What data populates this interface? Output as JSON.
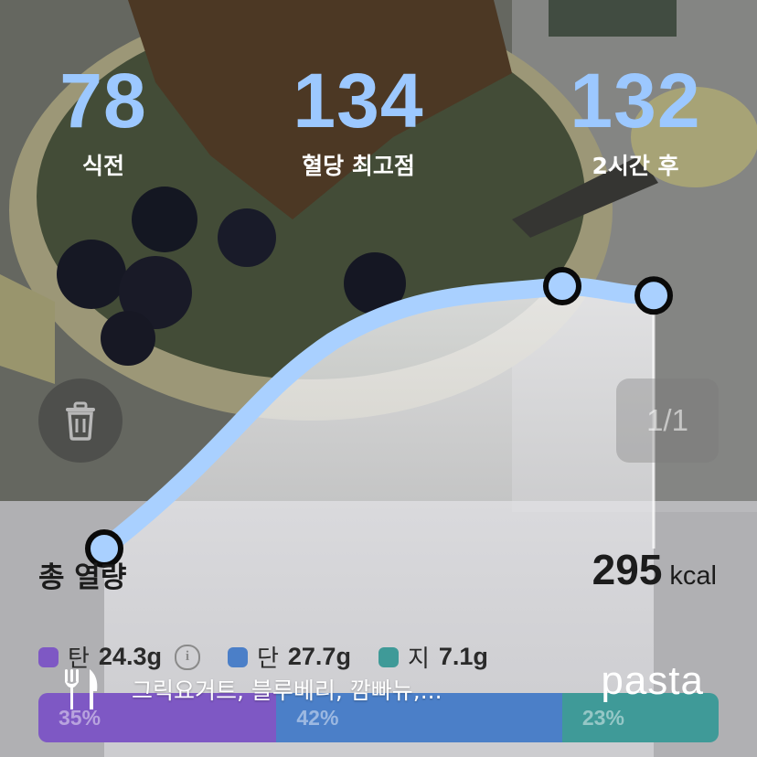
{
  "stats": {
    "before": {
      "value": "78",
      "label": "식전"
    },
    "peak": {
      "value": "134",
      "label": "혈당 최고점"
    },
    "after2h": {
      "value": "132",
      "label": "2시간 후"
    }
  },
  "glucose_curve": {
    "points": [
      78,
      134,
      132
    ]
  },
  "pager": {
    "text": "1/1"
  },
  "nutrition": {
    "total_label": "총 열량",
    "calories": "295",
    "unit": "kcal",
    "macros": [
      {
        "name": "탄",
        "grams": "24.3g",
        "percent": "35%",
        "color": "#7e58c4"
      },
      {
        "name": "단",
        "grams": "27.7g",
        "percent": "42%",
        "color": "#4b7fc8"
      },
      {
        "name": "지",
        "grams": "7.1g",
        "percent": "23%",
        "color": "#3f9a98"
      }
    ]
  },
  "meal": {
    "foods": "그릭요거트, 블루베리, 깜빠뉴,..."
  },
  "brand": "pasta",
  "colors": {
    "accent": "#9cc8ff"
  },
  "icons": {
    "trash": "trash-icon",
    "info": "info-icon",
    "meal": "fork-knife-icon"
  }
}
